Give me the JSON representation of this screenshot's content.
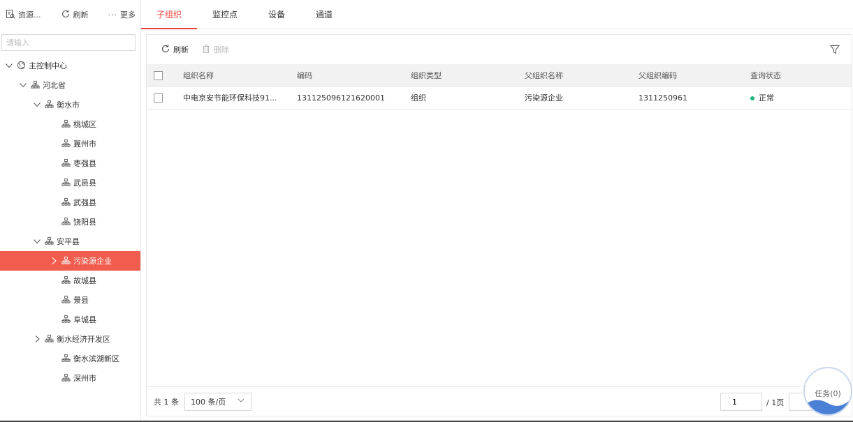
{
  "left_toolbar": {
    "resource_label": "资源...",
    "refresh_label": "刷新",
    "more_label": "更多"
  },
  "search": {
    "placeholder": "请输入"
  },
  "tree": [
    {
      "label": "主控制中心",
      "expanded": true,
      "has_toggle": true,
      "icon": "globe-icon"
    },
    {
      "label": "河北省",
      "expanded": true,
      "has_toggle": true,
      "icon": "org-icon"
    },
    {
      "label": "衡水市",
      "expanded": true,
      "has_toggle": true,
      "icon": "org-icon"
    },
    {
      "label": "桃城区",
      "has_toggle": false,
      "icon": "org-icon"
    },
    {
      "label": "冀州市",
      "has_toggle": false,
      "icon": "org-icon"
    },
    {
      "label": "枣强县",
      "has_toggle": false,
      "icon": "org-icon"
    },
    {
      "label": "武邑县",
      "has_toggle": false,
      "icon": "org-icon"
    },
    {
      "label": "武强县",
      "has_toggle": false,
      "icon": "org-icon"
    },
    {
      "label": "饶阳县",
      "has_toggle": false,
      "icon": "org-icon"
    },
    {
      "label": "安平县",
      "expanded": true,
      "has_toggle": true,
      "icon": "org-icon"
    },
    {
      "label": "污染源企业",
      "expanded": false,
      "has_toggle": true,
      "selected": true,
      "icon": "org-icon"
    },
    {
      "label": "故城县",
      "has_toggle": false,
      "icon": "org-icon"
    },
    {
      "label": "景县",
      "has_toggle": false,
      "icon": "org-icon"
    },
    {
      "label": "阜城县",
      "has_toggle": false,
      "icon": "org-icon"
    },
    {
      "label": "衡水经济开发区",
      "expanded": false,
      "has_toggle": true,
      "icon": "org-icon"
    },
    {
      "label": "衡水滨湖新区",
      "has_toggle": false,
      "icon": "org-icon"
    },
    {
      "label": "深州市",
      "has_toggle": false,
      "icon": "org-icon"
    }
  ],
  "tabs": [
    {
      "label": "子组织",
      "active": true
    },
    {
      "label": "监控点",
      "active": false
    },
    {
      "label": "设备",
      "active": false
    },
    {
      "label": "通道",
      "active": false
    }
  ],
  "panel_toolbar": {
    "refresh_label": "刷新",
    "delete_label": "删除"
  },
  "table": {
    "columns": [
      "组织名称",
      "编码",
      "组织类型",
      "父组织名称",
      "父组织编码",
      "查询状态"
    ],
    "rows": [
      {
        "name": "中电京安节能环保科技91...",
        "code": "131125096121620001",
        "type": "组织",
        "parent_name": "污染源企业",
        "parent_code": "1311250961",
        "status": "正常"
      }
    ]
  },
  "pager": {
    "total_text": "共 1 条",
    "page_size": "100 条/页",
    "current_page": "1",
    "total_pages": "/ 1页"
  },
  "task": {
    "label": "任务(0)"
  },
  "colors": {
    "accent": "#e8453c",
    "selected_bg": "#f05c4d",
    "status_ok": "#1fb57a",
    "task_wave": "#4a7fd6"
  }
}
